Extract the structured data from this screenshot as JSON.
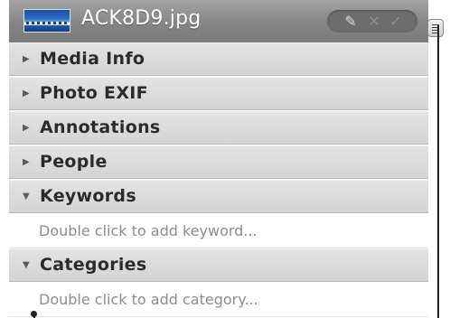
{
  "header": {
    "filename": "ACK8D9.jpg",
    "thumbnail_icon": "image-thumbnail-icon",
    "tools": {
      "edit_icon": "✎",
      "cancel_icon": "✕",
      "confirm_icon": "✓"
    },
    "menu_icon": "list-menu-icon"
  },
  "sections": [
    {
      "label": "Media Info",
      "expanded": false,
      "triangle": "▶"
    },
    {
      "label": "Photo EXIF",
      "expanded": false,
      "triangle": "▶"
    },
    {
      "label": "Annotations",
      "expanded": false,
      "triangle": "▶"
    },
    {
      "label": "People",
      "expanded": false,
      "triangle": "▶"
    },
    {
      "label": "Keywords",
      "expanded": true,
      "triangle": "▼",
      "placeholder": "Double click to add keyword..."
    },
    {
      "label": "Categories",
      "expanded": true,
      "triangle": "▼",
      "placeholder": "Double click to add category..."
    }
  ],
  "colors": {
    "header_bg": "#858585",
    "row_bg": "#dcdcdc",
    "placeholder_text": "#8c8c8c"
  }
}
